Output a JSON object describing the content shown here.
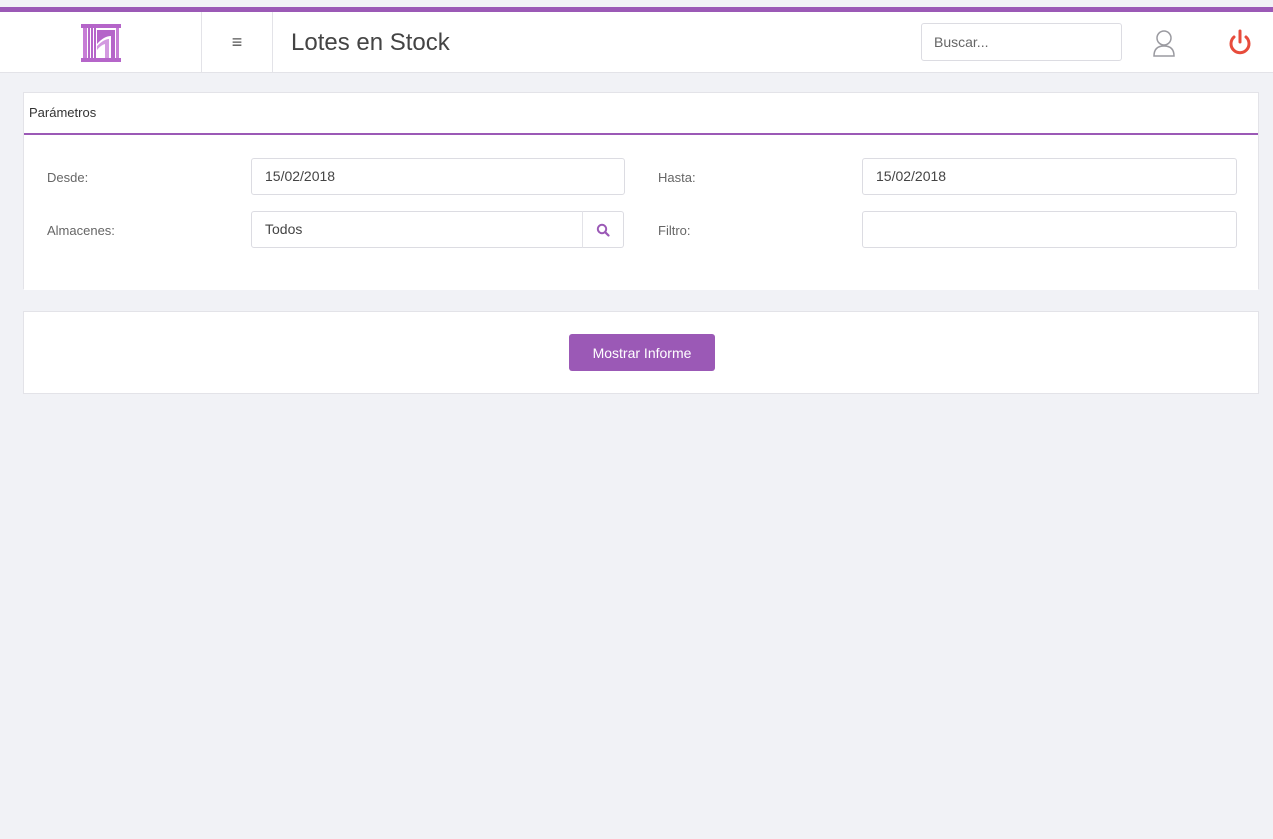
{
  "header": {
    "title": "Lotes en Stock",
    "menu_icon": "≡",
    "search_placeholder": "Buscar...",
    "accent_color": "#9b59b6",
    "power_color": "#e74c3c"
  },
  "params": {
    "heading": "Parámetros",
    "desde_label": "Desde:",
    "desde_value": "15/02/2018",
    "hasta_label": "Hasta:",
    "hasta_value": "15/02/2018",
    "almacenes_label": "Almacenes:",
    "almacenes_value": "Todos",
    "filtro_label": "Filtro:",
    "filtro_value": ""
  },
  "actions": {
    "show_report_label": "Mostrar Informe"
  }
}
